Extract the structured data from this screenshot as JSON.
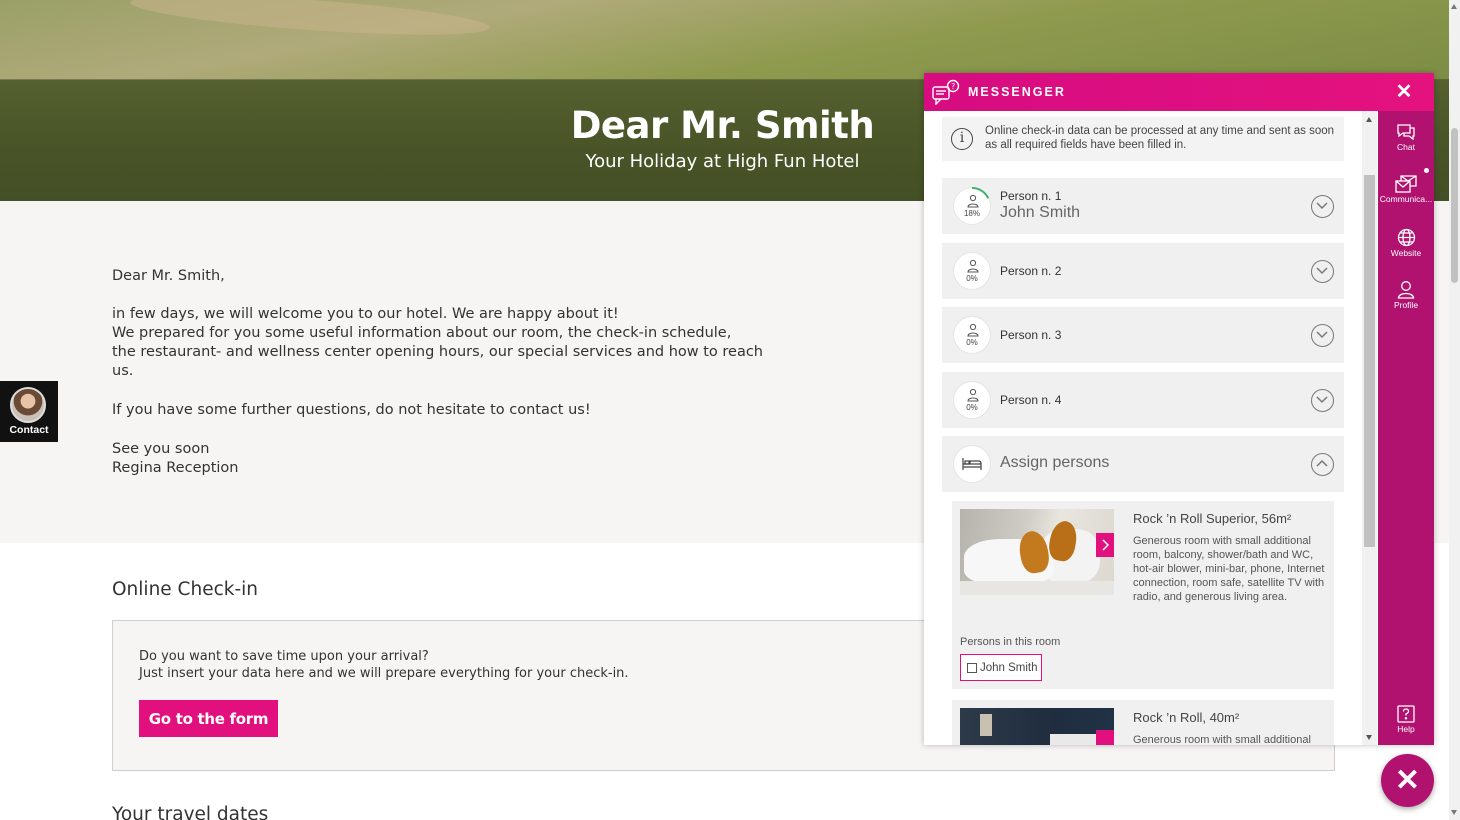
{
  "hero": {
    "title": "Dear Mr. Smith",
    "subtitle": "Your Holiday at High Fun Hotel"
  },
  "letter": {
    "greeting": "Dear Mr. Smith,",
    "p1_l1": "in few days, we will welcome you to our hotel. We are happy about it!",
    "p1_l2": "We prepared for you some useful information about our room, the check-in schedule,",
    "p1_l3": "the restaurant- and wellness center opening hours, our special services and how to reach",
    "p1_l4": "us.",
    "p2": "If you have some further questions, do not hesitate to contact us!",
    "closing": "See you soon",
    "signature": "Regina Reception"
  },
  "checkin": {
    "title": "Online Check-in",
    "line1": "Do you want to save time upon your arrival?",
    "line2": "Just insert your data here and we will prepare everything for your check-in.",
    "button": "Go to the form"
  },
  "travel": {
    "title": "Your travel dates"
  },
  "contact": {
    "label": "Contact"
  },
  "messenger": {
    "title": "MESSENGER",
    "close": "✕",
    "info": "Online check-in data can be processed at any time and sent as soon as all required fields have been filled in.",
    "persons": [
      {
        "label": "Person n. 1",
        "name": "John Smith",
        "percent": "18%",
        "progress": 18
      },
      {
        "label": "Person n. 2",
        "name": "",
        "percent": "0%",
        "progress": 0
      },
      {
        "label": "Person n. 3",
        "name": "",
        "percent": "0%",
        "progress": 0
      },
      {
        "label": "Person n. 4",
        "name": "",
        "percent": "0%",
        "progress": 0
      }
    ],
    "assign": "Assign persons",
    "rooms": [
      {
        "title": "Rock ’n Roll Superior, 56m²",
        "description": "Generous room with small additional room, balcony, shower/bath and WC, hot-air blower, mini-bar, phone, Internet connection, room safe, satellite TV with radio, and generous living area.",
        "persons_label": "Persons in this room",
        "person_chip": "John Smith"
      },
      {
        "title": "Rock ’n Roll, 40m²",
        "description": "Generous room with small additional"
      }
    ],
    "sidebar": [
      {
        "label": "Chat",
        "icon": "chat-icon"
      },
      {
        "label": "Communica...",
        "icon": "communication-icon"
      },
      {
        "label": "Website",
        "icon": "globe-icon"
      },
      {
        "label": "Profile",
        "icon": "profile-icon"
      },
      {
        "label": "Help",
        "icon": "help-icon"
      }
    ]
  },
  "fab": {
    "label": "✕"
  },
  "colors": {
    "accent": "#e20f7e",
    "sidebar": "#b1126f",
    "panel": "#f0f0f0"
  }
}
